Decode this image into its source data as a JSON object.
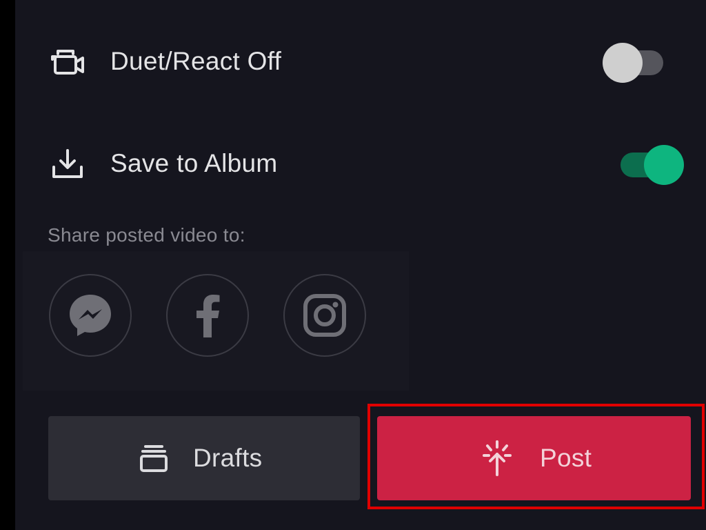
{
  "settings": {
    "duet": {
      "label": "Duet/React Off",
      "enabled": false,
      "icon": "duet-camera-icon"
    },
    "save_to_album": {
      "label": "Save to Album",
      "enabled": true,
      "icon": "download-icon"
    }
  },
  "share": {
    "label": "Share posted video to:",
    "targets": [
      {
        "name": "Messenger",
        "icon": "messenger-icon"
      },
      {
        "name": "Facebook",
        "icon": "facebook-icon"
      },
      {
        "name": "Instagram",
        "icon": "instagram-icon"
      }
    ]
  },
  "actions": {
    "drafts": {
      "label": "Drafts",
      "icon": "drafts-icon"
    },
    "post": {
      "label": "Post",
      "icon": "post-arrow-icon"
    }
  },
  "colors": {
    "background": "#15151e",
    "toggle_on": "#0eb57f",
    "post_button": "#cc2244",
    "drafts_button": "#2d2d35",
    "highlight": "#e00000"
  }
}
